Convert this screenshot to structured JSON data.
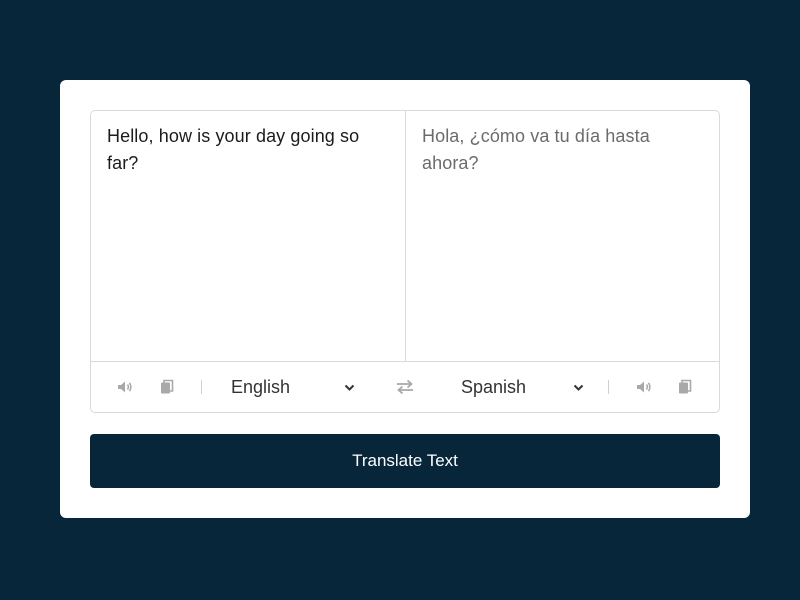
{
  "from": {
    "text": "Hello, how is your day going so far?",
    "language": "English"
  },
  "to": {
    "text": "Hola, ¿cómo va tu día hasta ahora?",
    "language": "Spanish"
  },
  "icons": {
    "speak": "volume-icon",
    "copy": "copy-icon",
    "exchange": "exchange-icon",
    "dropdown": "chevron-down-icon"
  },
  "button": {
    "translate_label": "Translate Text"
  },
  "colors": {
    "background": "#08263a",
    "card": "#ffffff",
    "button": "#08263a",
    "icon": "#a9a9a9"
  }
}
